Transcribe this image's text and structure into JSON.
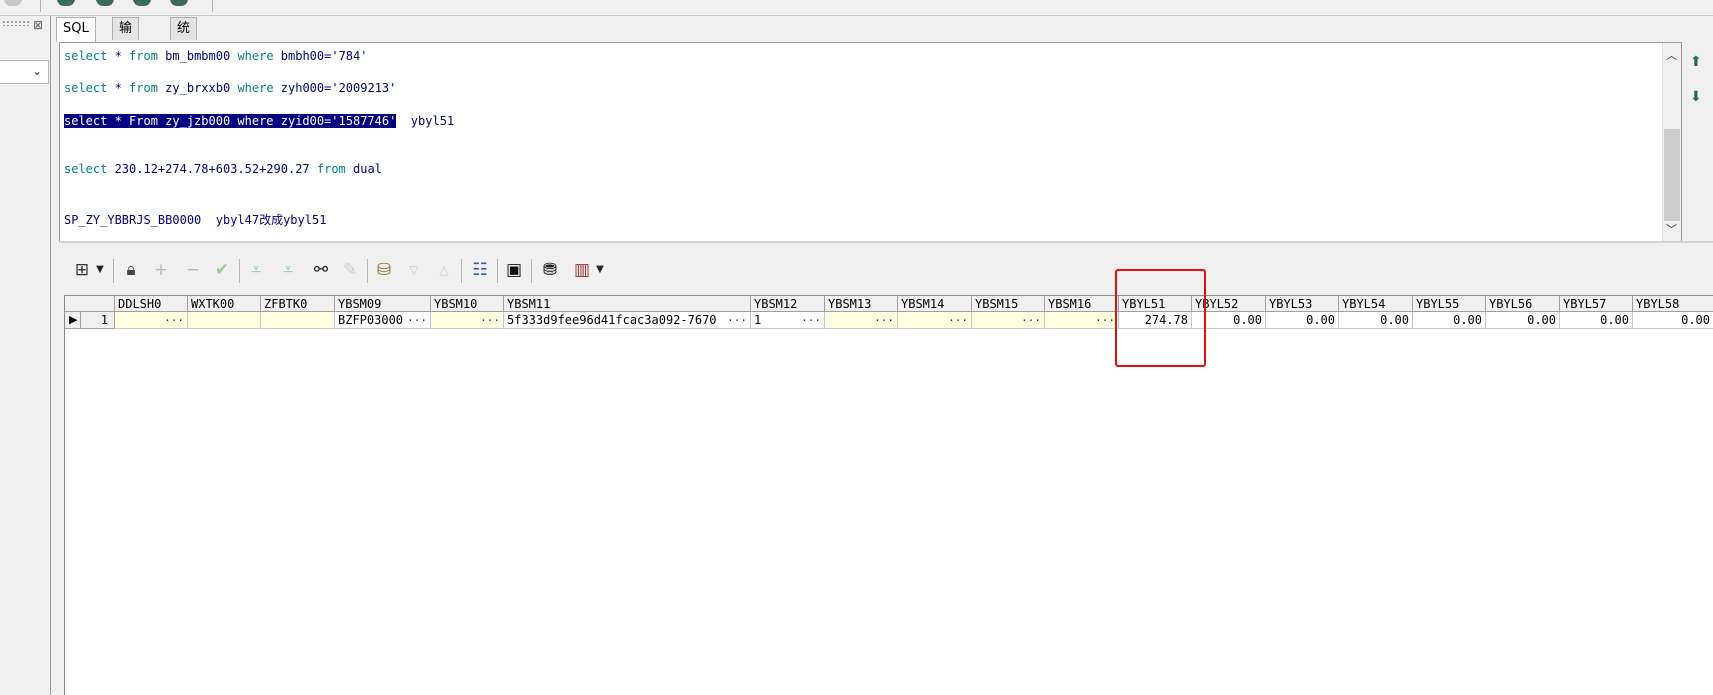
{
  "tabs": [
    {
      "label": "SQL",
      "active": true
    },
    {
      "label": "输出",
      "active": false
    },
    {
      "label": "统计表",
      "active": false
    }
  ],
  "editor": {
    "lines": [
      {
        "kw1": "select",
        "mid": " * ",
        "kw2": "from",
        "rest": " bm_bmbm00 ",
        "kw3": "where",
        "cond": " bmbh00='784'"
      },
      {
        "kw1": "select",
        "mid": " * ",
        "kw2": "from",
        "rest": " zy_brxxb0 ",
        "kw3": "where",
        "cond": " zyh000='2009213'"
      },
      {
        "selected": "select * From zy_jzb000 where zyid00='1587746'",
        "tail": "  ybyl51"
      },
      {
        "kw1": "select",
        "expr": " 230.12+274.78+603.52+290.27 ",
        "kw2": "from",
        "tail": " dual"
      },
      {
        "text": "SP_ZY_YBBRJS_BB0000  ybyl47改成ybyl51"
      }
    ]
  },
  "grid": {
    "columns": [
      "DDLSH0",
      "WXTK00",
      "ZFBTK0",
      "YBSM09",
      "YBSM10",
      "YBSM11",
      "YBSM12",
      "YBSM13",
      "YBSM14",
      "YBSM15",
      "YBSM16",
      "YBYL51",
      "YBYL52",
      "YBYL53",
      "YBYL54",
      "YBYL55",
      "YBYL56",
      "YBYL57",
      "YBYL58"
    ],
    "rows": [
      {
        "num": "1",
        "cells": [
          "",
          "",
          "",
          "BZFP03000",
          "",
          "5f333d9fee96d41fcac3a092-7670",
          "1",
          "",
          "",
          "",
          "",
          "274.78",
          "0.00",
          "0.00",
          "0.00",
          "0.00",
          "0.00",
          "0.00",
          "0.00"
        ]
      }
    ],
    "ellipsis": "···"
  },
  "icons": {
    "grid_menu": "table-grid-icon",
    "lock": "lock-icon",
    "add": "plus-icon",
    "remove": "minus-icon",
    "confirm": "check-icon",
    "find": "binoculars-icon",
    "save": "floppy-icon",
    "chart": "bar-chart-icon"
  },
  "colors": {
    "highlight": "#e01010",
    "selection": "#000080",
    "keyword": "#007f7f",
    "cell_bg": "#ffffe1"
  }
}
